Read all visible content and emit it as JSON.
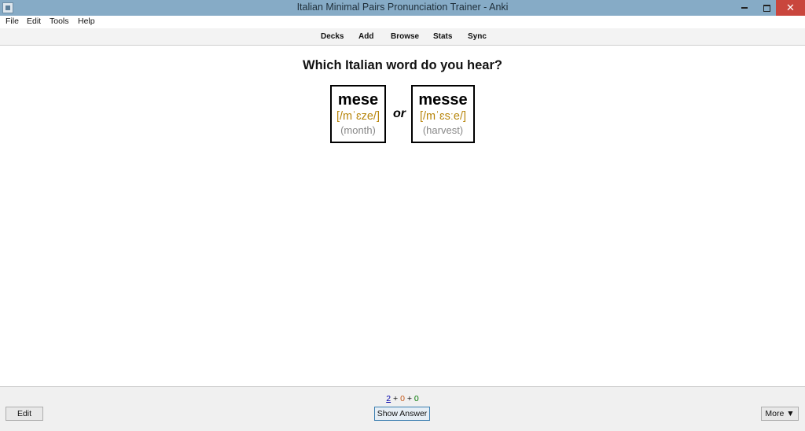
{
  "window": {
    "title": "Italian Minimal Pairs Pronunciation Trainer - Anki"
  },
  "menu": {
    "items": [
      "File",
      "Edit",
      "Tools",
      "Help"
    ]
  },
  "toolbar": {
    "items": [
      "Decks",
      "Add",
      "Browse",
      "Stats",
      "Sync"
    ]
  },
  "card": {
    "question": "Which Italian word do you hear?",
    "connector": "or",
    "words": [
      {
        "word": "mese",
        "ipa": "[/mˈɛze/]",
        "gloss": "(month)"
      },
      {
        "word": "messe",
        "ipa": "[/mˈɛsːe/]",
        "gloss": "(harvest)"
      }
    ]
  },
  "bottom": {
    "counts": {
      "new": "2",
      "learning": "0",
      "review": "0",
      "separator": "+"
    },
    "edit_label": "Edit",
    "show_answer_label": "Show Answer",
    "more_label": "More ▼"
  },
  "colors": {
    "titlebar": "#86abc6",
    "close_button": "#c9463d",
    "ipa": "#b8860b",
    "new_count": "#0000aa",
    "learning_count": "#c35617",
    "review_count": "#007700"
  }
}
